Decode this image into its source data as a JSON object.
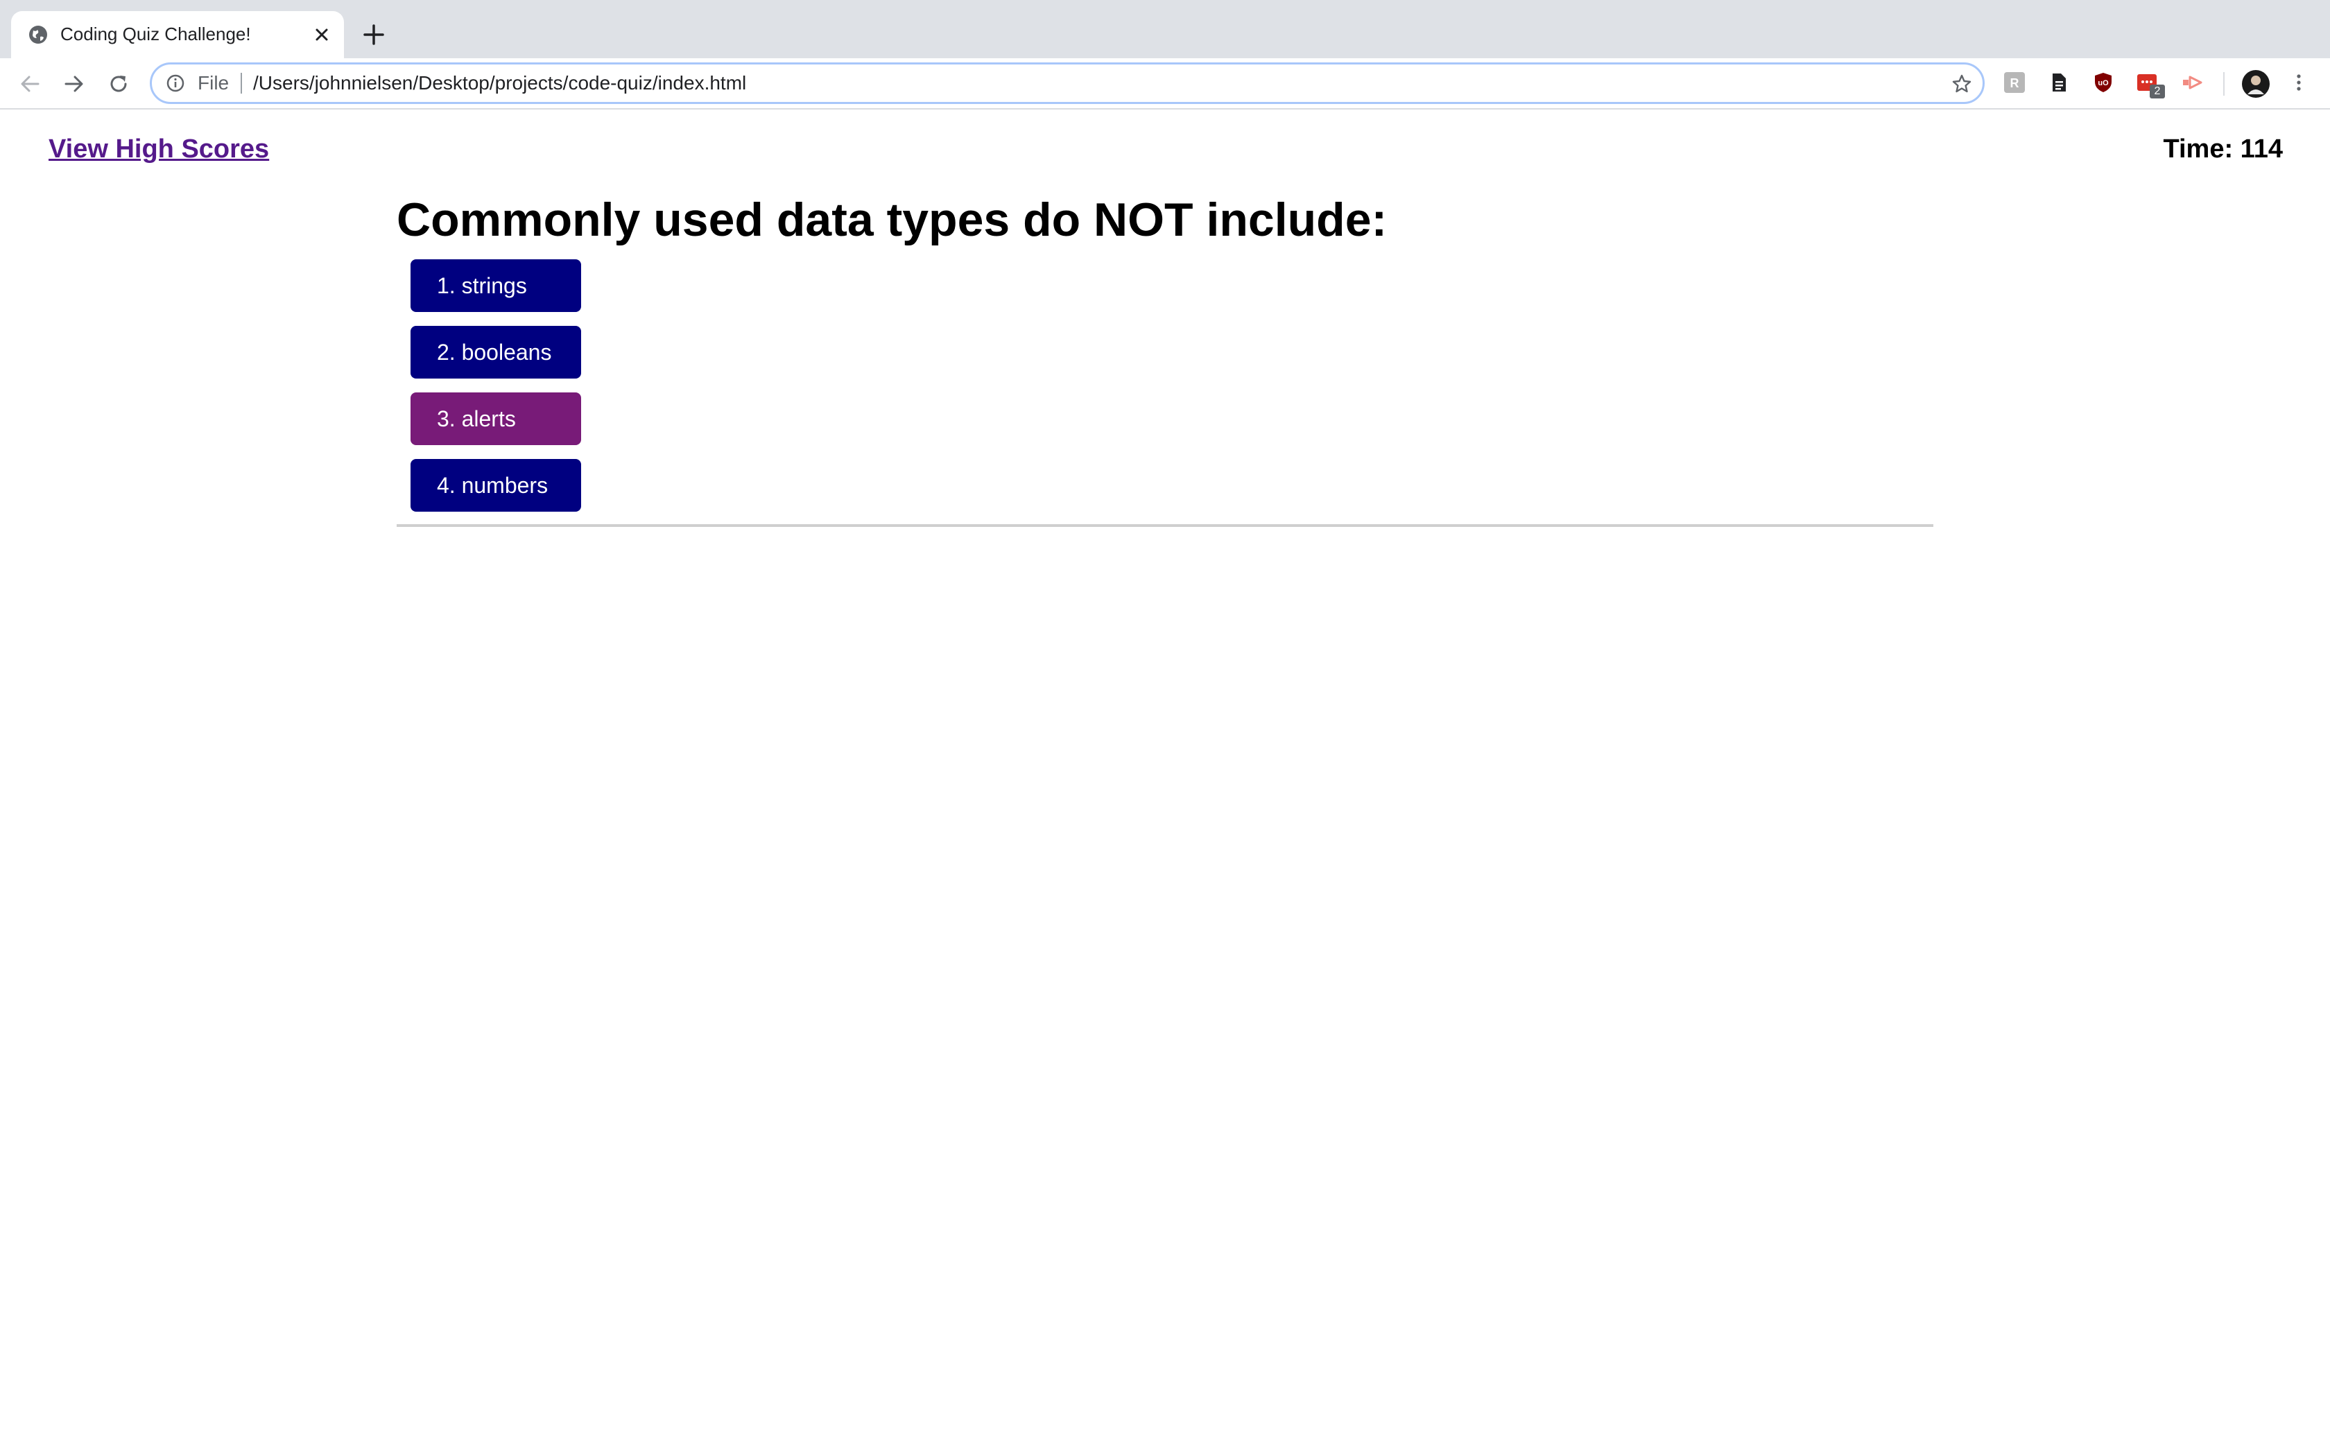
{
  "browser": {
    "tab_title": "Coding Quiz Challenge!",
    "address_scheme": "File",
    "address_url": "/Users/johnnielsen/Desktop/projects/code-quiz/index.html",
    "extension_badge_count": "2",
    "icons": [
      "globe-icon",
      "close-icon",
      "plus-icon",
      "back-icon",
      "forward-icon",
      "reload-icon",
      "info-icon",
      "star-icon",
      "kebab-menu-icon"
    ]
  },
  "header": {
    "highscores_label": "View High Scores",
    "timer_label": "Time: 114"
  },
  "quiz": {
    "question": "Commonly used data types do NOT include:",
    "choices": [
      {
        "label": "1. strings"
      },
      {
        "label": "2. booleans"
      },
      {
        "label": "3. alerts"
      },
      {
        "label": "4. numbers"
      }
    ],
    "colors": {
      "button": "#000080",
      "button_hover": "#781b78",
      "link": "#551a8b"
    }
  }
}
